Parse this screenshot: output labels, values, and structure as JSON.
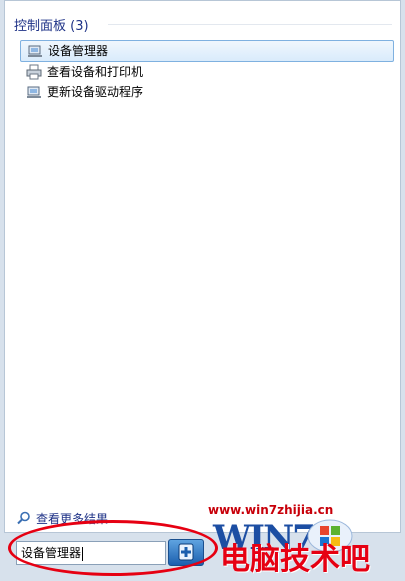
{
  "group": {
    "title": "控制面板 (3)"
  },
  "results": [
    {
      "label": "设备管理器",
      "icon": "device-manager-icon",
      "selected": true
    },
    {
      "label": "查看设备和打印机",
      "icon": "printer-icon",
      "selected": false
    },
    {
      "label": "更新设备驱动程序",
      "icon": "driver-update-icon",
      "selected": false
    }
  ],
  "more_results": {
    "label": "查看更多结果",
    "icon": "search-icon"
  },
  "search": {
    "value": "设备管理器"
  },
  "watermark": {
    "url": "www.win7zhijia.cn",
    "brand": "WIN7",
    "cn_text": "电脑技术吧"
  },
  "colors": {
    "header_text": "#1e3287",
    "highlight_border": "#7fb1e0",
    "annotation_red": "#e60012"
  }
}
